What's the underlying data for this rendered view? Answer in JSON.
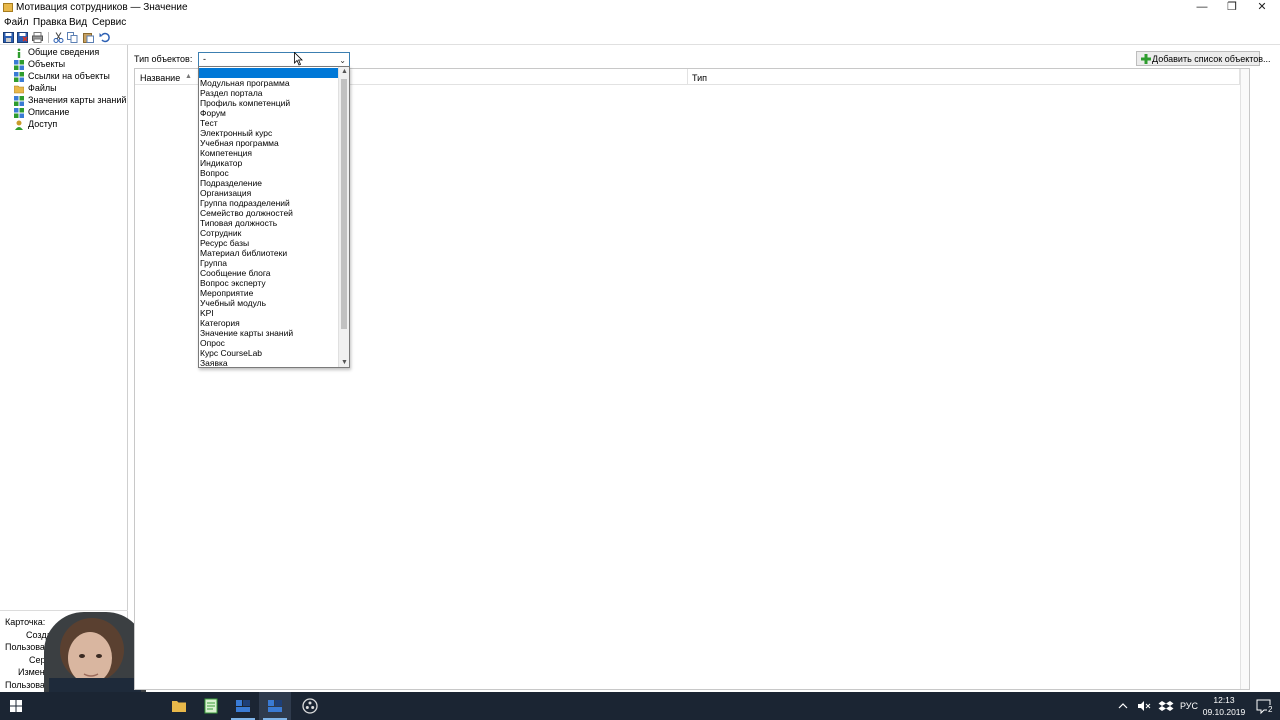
{
  "window": {
    "title": "Мотивация сотрудников — Значение",
    "minimize": "—",
    "restore": "❐",
    "close": "✕"
  },
  "menu": [
    "Файл",
    "Правка",
    "Вид",
    "Сервис"
  ],
  "toolbar": {
    "buttons": [
      "save-icon",
      "save-close-icon",
      "print-icon",
      "cut-icon",
      "copy-icon",
      "paste-icon",
      "undo-icon"
    ]
  },
  "sidebar": {
    "items": [
      {
        "label": "Общие сведения",
        "icon": "info-icon",
        "color": "#2e9c2e"
      },
      {
        "label": "Объекты",
        "icon": "objects-icon",
        "color": "#3a7bd5"
      },
      {
        "label": "Ссылки на объекты",
        "icon": "links-icon",
        "color": "#3a7bd5"
      },
      {
        "label": "Файлы",
        "icon": "folder-icon",
        "color": "#e8b84a"
      },
      {
        "label": "Значения карты знаний",
        "icon": "knowledge-map-icon",
        "color": "#3a7bd5"
      },
      {
        "label": "Описание",
        "icon": "description-icon",
        "color": "#3a7bd5"
      },
      {
        "label": "Доступ",
        "icon": "access-icon",
        "color": "#c89b2a"
      }
    ]
  },
  "card_info": {
    "header": "Карточка:",
    "created": "Создана:",
    "user1": "Пользователь:",
    "server": "Сервер:",
    "changed": "Изменена:",
    "user2": "Пользователь:"
  },
  "main": {
    "type_label": "Тип объектов:",
    "type_value": "-",
    "add_button": "Добавить список объектов...",
    "columns": [
      {
        "label": "Название",
        "sort": "▲"
      },
      {
        "label": "Тип"
      }
    ]
  },
  "dropdown": {
    "selected": "",
    "items": [
      "Модульная программа",
      "Раздел портала",
      "Профиль компетенций",
      "Форум",
      "Тест",
      "Электронный курс",
      "Учебная программа",
      "Компетенция",
      "Индикатор",
      "Вопрос",
      "Подразделение",
      "Организация",
      "Группа подразделений",
      "Семейство должностей",
      "Типовая должность",
      "Сотрудник",
      "Ресурс базы",
      "Материал библиотеки",
      "Группа",
      "Сообщение блога",
      "Вопрос эксперту",
      "Мероприятие",
      "Учебный модуль",
      "KPI",
      "Категория",
      "Значение карты знаний",
      "Опрос",
      "Курс CourseLab",
      "Заявка"
    ]
  },
  "taskbar": {
    "apps": [
      "windows-start-icon",
      "file-explorer-icon",
      "notepad-icon",
      "app-icon-1",
      "app-icon-2",
      "obs-icon"
    ],
    "tray": {
      "language": "РУС",
      "time": "12:13",
      "date": "09.10.2019",
      "notifications": "2"
    }
  }
}
